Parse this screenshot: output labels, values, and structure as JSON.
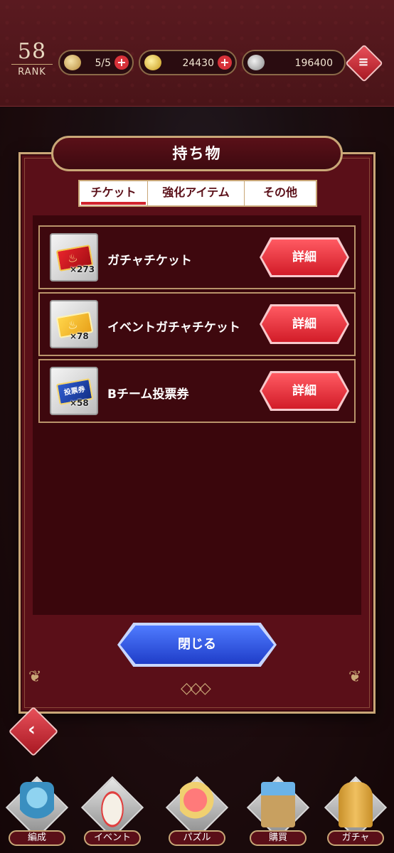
{
  "header": {
    "rank_value": "58",
    "rank_label": "RANK",
    "stamina": "5/5",
    "coins": "24430",
    "silver": "196400",
    "plus_symbol": "+",
    "menu_icon": "menu-icon"
  },
  "dialog": {
    "title": "持ち物",
    "tabs": [
      {
        "label": "チケット",
        "active": true
      },
      {
        "label": "強化アイテム",
        "active": false
      },
      {
        "label": "その他",
        "active": false
      }
    ],
    "items": [
      {
        "name": "ガチャチケット",
        "count": "×273",
        "icon": "red-ticket-icon",
        "button": "詳細"
      },
      {
        "name": "イベントガチャチケット",
        "count": "×78",
        "icon": "gold-ticket-icon",
        "button": "詳細"
      },
      {
        "name": "Bチーム投票券",
        "count": "×58",
        "icon": "vote-ticket-icon",
        "button": "詳細",
        "ticket_text": "投票券"
      }
    ],
    "close_label": "閉じる"
  },
  "bottom_nav": [
    {
      "label": "編成"
    },
    {
      "label": "イベント"
    },
    {
      "label": "パズル"
    },
    {
      "label": "購買"
    },
    {
      "label": "ガチャ"
    }
  ],
  "colors": {
    "accent_red": "#d1232d",
    "gold_border": "#c9a777",
    "panel": "#5a0f18",
    "close_blue": "#1f3dc8"
  }
}
